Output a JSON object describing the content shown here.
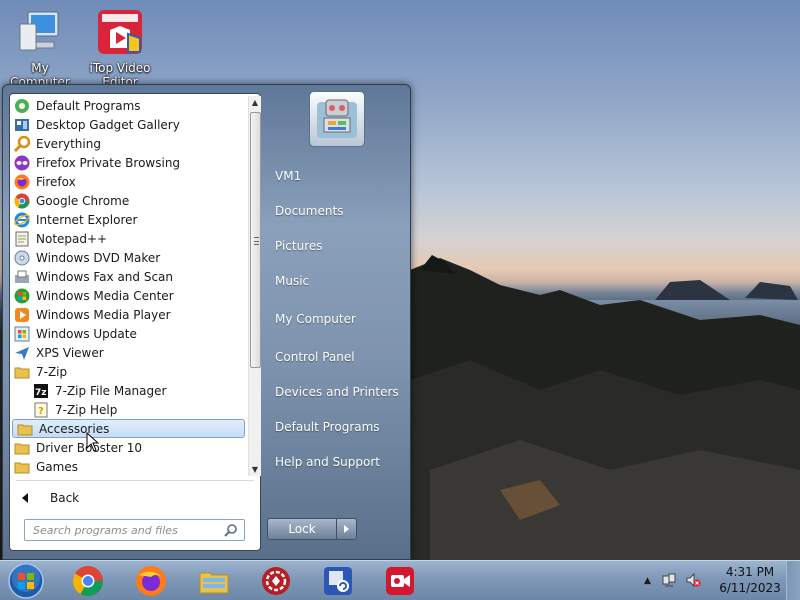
{
  "desktop": {
    "icons": [
      {
        "label": "My Computer"
      },
      {
        "label": "iTop Video Editor"
      }
    ]
  },
  "start_menu": {
    "programs": [
      {
        "label": "Default Programs",
        "icon": "default-programs-icon"
      },
      {
        "label": "Desktop Gadget Gallery",
        "icon": "gadget-gallery-icon"
      },
      {
        "label": "Everything",
        "icon": "everything-search-icon"
      },
      {
        "label": "Firefox Private Browsing",
        "icon": "firefox-private-icon"
      },
      {
        "label": "Firefox",
        "icon": "firefox-icon"
      },
      {
        "label": "Google Chrome",
        "icon": "chrome-icon"
      },
      {
        "label": "Internet Explorer",
        "icon": "internet-explorer-icon"
      },
      {
        "label": "Notepad++",
        "icon": "notepad-plus-icon"
      },
      {
        "label": "Windows DVD Maker",
        "icon": "dvd-maker-icon"
      },
      {
        "label": "Windows Fax and Scan",
        "icon": "fax-scan-icon"
      },
      {
        "label": "Windows Media Center",
        "icon": "media-center-icon"
      },
      {
        "label": "Windows Media Player",
        "icon": "media-player-icon"
      },
      {
        "label": "Windows Update",
        "icon": "windows-update-icon"
      },
      {
        "label": "XPS Viewer",
        "icon": "xps-viewer-icon"
      },
      {
        "label": "7-Zip",
        "icon": "folder-icon"
      },
      {
        "label": "7-Zip File Manager",
        "icon": "7zip-icon"
      },
      {
        "label": "7-Zip Help",
        "icon": "help-file-icon"
      },
      {
        "label": "Accessories",
        "icon": "folder-icon"
      },
      {
        "label": "Driver Booster 10",
        "icon": "folder-icon"
      },
      {
        "label": "Games",
        "icon": "folder-icon"
      }
    ],
    "selected_program": "Accessories",
    "back_label": "Back",
    "search_placeholder": "Search programs and files",
    "right_items": [
      "VM1",
      "Documents",
      "Pictures",
      "Music",
      "My Computer",
      "Control Panel",
      "Devices and Printers",
      "Default Programs",
      "Help and Support"
    ],
    "lock_label": "Lock"
  },
  "taskbar": {
    "pinned": [
      {
        "name": "Google Chrome",
        "icon": "chrome-icon"
      },
      {
        "name": "Firefox",
        "icon": "firefox-icon"
      },
      {
        "name": "Windows Explorer",
        "icon": "explorer-folder-icon"
      },
      {
        "name": "iObit Driver Booster",
        "icon": "driver-booster-icon"
      },
      {
        "name": "Screen Capture",
        "icon": "screen-capture-icon"
      },
      {
        "name": "iTop Screen Recorder",
        "icon": "screen-recorder-icon"
      }
    ],
    "clock": {
      "time": "4:31 PM",
      "date": "6/11/2023"
    }
  },
  "colors": {
    "accent": "#3f7fd6",
    "selection": "#c6dcf6",
    "taskbar": "#7f98b7"
  }
}
